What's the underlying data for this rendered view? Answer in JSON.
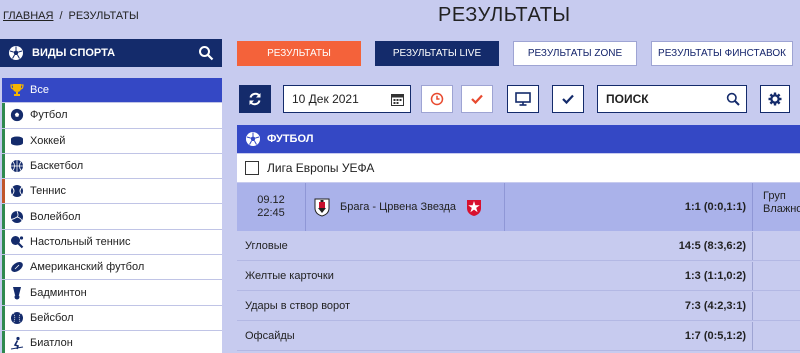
{
  "breadcrumb": {
    "home": "ГЛАВНАЯ",
    "separator": "/",
    "current": "РЕЗУЛЬТАТЫ"
  },
  "page_title": "РЕЗУЛЬТАТЫ",
  "sidebar": {
    "header": "ВИДЫ СПОРТА",
    "items": [
      {
        "label": "Все",
        "icon": "trophy-icon",
        "active": true
      },
      {
        "label": "Футбол",
        "icon": "football-icon",
        "color": "#2f8a4f"
      },
      {
        "label": "Хоккей",
        "icon": "hockey-puck-icon",
        "color": "#2f8a4f"
      },
      {
        "label": "Баскетбол",
        "icon": "basketball-icon",
        "color": "#2f8a4f"
      },
      {
        "label": "Теннис",
        "icon": "tennis-ball-icon",
        "color": "#c0562c"
      },
      {
        "label": "Волейбол",
        "icon": "volleyball-icon",
        "color": "#2f8a4f"
      },
      {
        "label": "Настольный теннис",
        "icon": "table-tennis-icon",
        "color": "#2f8a4f"
      },
      {
        "label": "Американский футбол",
        "icon": "american-football-icon",
        "color": "#2f8a4f"
      },
      {
        "label": "Бадминтон",
        "icon": "shuttlecock-icon",
        "color": "#2f8a4f"
      },
      {
        "label": "Бейсбол",
        "icon": "baseball-icon",
        "color": "#2f8a4f"
      },
      {
        "label": "Биатлон",
        "icon": "biathlon-icon",
        "color": "#2f8a4f"
      }
    ]
  },
  "top_buttons": {
    "results": "РЕЗУЛЬТАТЫ",
    "results_live": "РЕЗУЛЬТАТЫ LIVE",
    "results_zone": "РЕЗУЛЬТАТЫ ZONE",
    "results_finstavok": "РЕЗУЛЬТАТЫ ФИНСТАВОК"
  },
  "toolbar": {
    "date_value": "10 Дек 2021",
    "search_value": "ПОИСК"
  },
  "sport_header": "ФУТБОЛ",
  "league": "Лига Европы УЕФА",
  "match": {
    "date": "09.12",
    "time": "22:45",
    "teams": "Брага - Црвена Звезда",
    "score": "1:1 (0:0,1:1)",
    "weather_line1": "Груп",
    "weather_line2": "Влажност"
  },
  "stats": [
    {
      "label": "Угловые",
      "value": "14:5 (8:3,6:2)"
    },
    {
      "label": "Желтые карточки",
      "value": "1:3 (1:1,0:2)"
    },
    {
      "label": "Удары в створ ворот",
      "value": "7:3 (4:2,3:1)"
    },
    {
      "label": "Офсайды",
      "value": "1:7 (0:5,1:2)"
    }
  ],
  "colors": {
    "navy": "#142b6b",
    "blue": "#3448c5",
    "accent_red": "#f4623a",
    "page_bg": "#c7cbef"
  }
}
